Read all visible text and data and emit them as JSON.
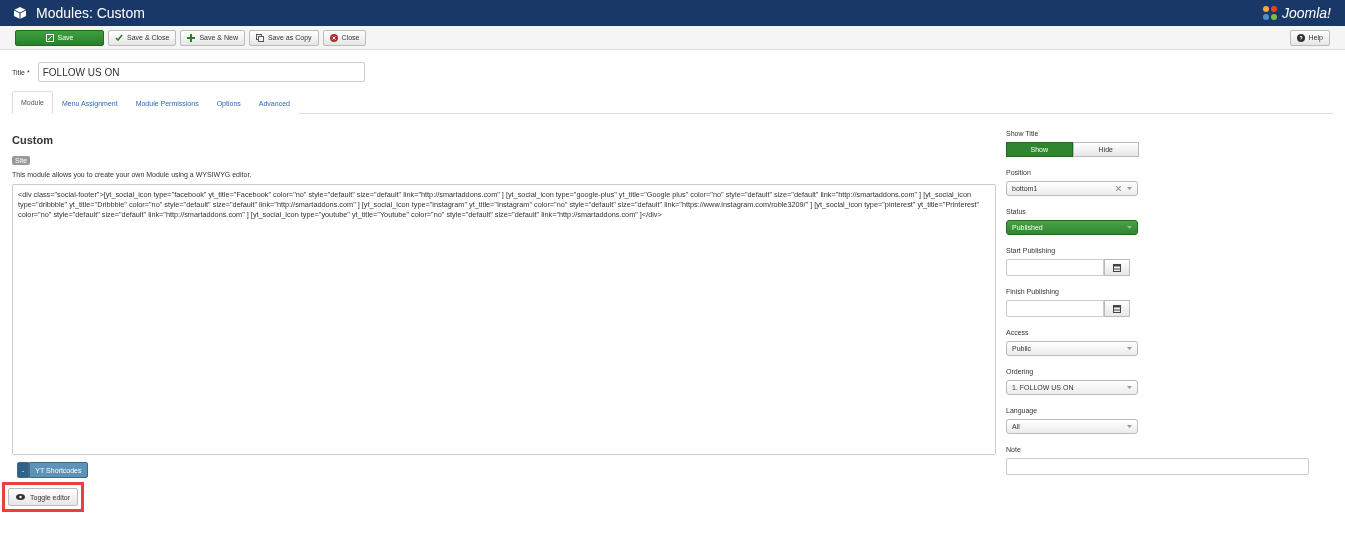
{
  "header": {
    "title": "Modules: Custom",
    "brand": "Joomla!"
  },
  "toolbar": {
    "buttons": [
      {
        "label": "Save",
        "kind": "primary"
      },
      {
        "label": "Save & Close",
        "kind": "check"
      },
      {
        "label": "Save & New",
        "kind": "plus"
      },
      {
        "label": "Save as Copy",
        "kind": "copy"
      },
      {
        "label": "Close",
        "kind": "cancel"
      }
    ],
    "help": "Help"
  },
  "title_field": {
    "label": "Title",
    "required_mark": "*",
    "value": "FOLLOW US ON"
  },
  "tabs": [
    {
      "label": "Module",
      "selected": true
    },
    {
      "label": "Menu Assignment",
      "selected": false
    },
    {
      "label": "Module Permissions",
      "selected": false
    },
    {
      "label": "Options",
      "selected": false
    },
    {
      "label": "Advanced",
      "selected": false
    }
  ],
  "module": {
    "heading": "Custom",
    "badge": "Site",
    "description": "This module allows you to create your own Module using a WYSIWYG editor.",
    "editor_text": "<div class=\"social-footer\">[yt_social_icon type=\"facebook\" yt_title=\"Facebook\" color=\"no\" style=\"default\" size=\"default\" link=\"http://smartaddons.com\" ] [yt_social_icon type=\"google-plus\" yt_title=\"Google plus\" color=\"no\" style=\"default\" size=\"default\" link=\"http://smartaddons.com\" ] [yt_social_icon type=\"dribbble\" yt_title=\"Dribbble\" color=\"no\" style=\"default\" size=\"default\" link=\"http://smartaddons.com\" ] [yt_social_icon type=\"instagram\" yt_title=\"Instagram\" color=\"no\" style=\"default\" size=\"default\" link=\"https://www.instagram.com/roble3209/\" ] [yt_social_icon type=\"pinterest\" yt_title=\"Printerest\" color=\"no\" style=\"default\" size=\"default\" link=\"http://smartaddons.com\" ] [yt_social_icon type=\"youtube\" yt_title=\"Youtube\" color=\"no\" style=\"default\" size=\"default\" link=\"http://smartaddons.com\" ]</div>",
    "shortcodes": {
      "toggle": "-",
      "label": "YT Shortcodes"
    },
    "toggle_editor": {
      "label": "Toggle editor",
      "highlighted": true
    }
  },
  "sidebar": [
    {
      "kind": "toggle",
      "label": "Show Title",
      "options": [
        {
          "label": "Show",
          "selected": true
        },
        {
          "label": "Hide",
          "selected": false
        }
      ]
    },
    {
      "kind": "select",
      "label": "Position",
      "value": "bottom1",
      "clearable": true
    },
    {
      "kind": "status",
      "label": "Status",
      "value": "Published"
    },
    {
      "kind": "date",
      "label": "Start Publishing"
    },
    {
      "kind": "date",
      "label": "Finish Publishing"
    },
    {
      "kind": "select",
      "label": "Access",
      "value": "Public"
    },
    {
      "kind": "select",
      "label": "Ordering",
      "value": "1. FOLLOW US ON"
    },
    {
      "kind": "select",
      "label": "Language",
      "value": "All"
    },
    {
      "kind": "text",
      "label": "Note"
    }
  ]
}
